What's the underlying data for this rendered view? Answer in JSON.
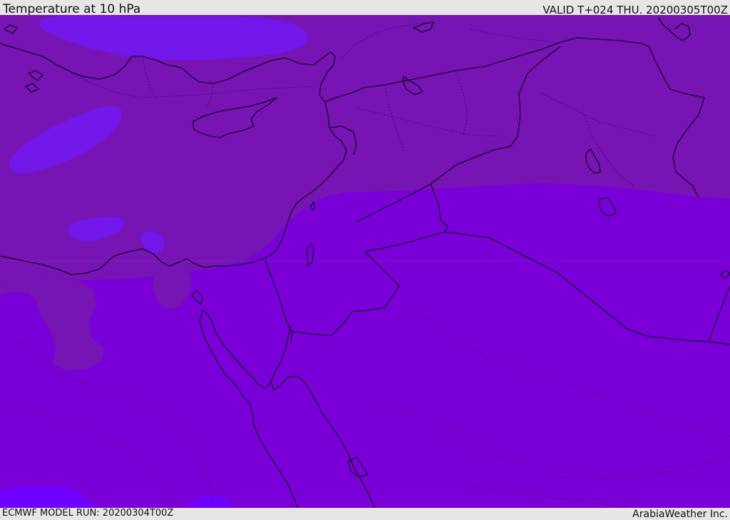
{
  "header": {
    "title": "Temperature at 10 hPa",
    "valid_time": "VALID T+024 THU. 20200305T00Z"
  },
  "footer": {
    "model_run": "ECMWF MODEL RUN: 20200304T00Z",
    "credit": "ArabiaWeather Inc."
  },
  "map": {
    "region": "Eastern Mediterranean and Middle East",
    "field": "Temperature at 10 hPa",
    "colors": {
      "warm_band": "#7714b4",
      "main_fill": "#7a00d8",
      "cold_pocket": "#7316ea",
      "coldest_pocket": "#7000ff",
      "coastline": "#000000"
    }
  }
}
